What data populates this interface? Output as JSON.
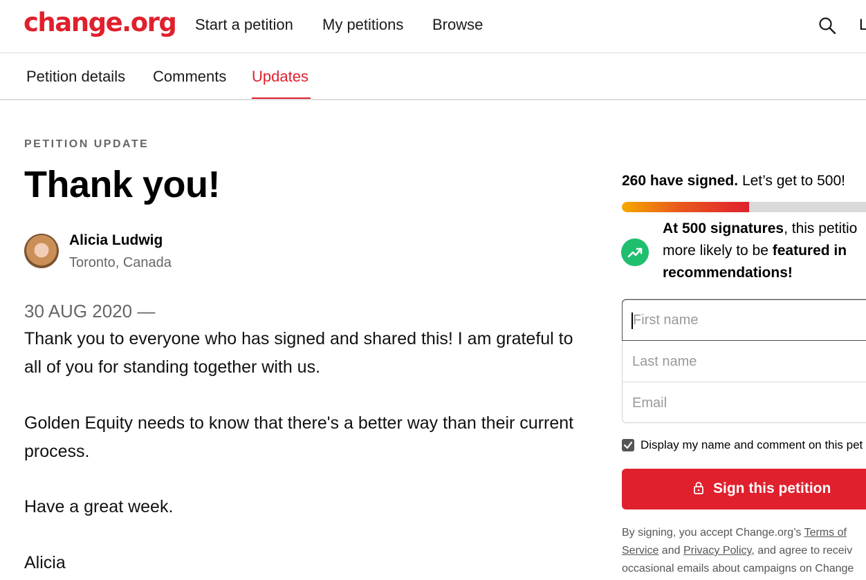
{
  "header": {
    "logo": "change.org",
    "nav": [
      "Start a petition",
      "My petitions",
      "Browse"
    ],
    "login_partial": "L"
  },
  "tabs": [
    {
      "label": "Petition details",
      "active": false
    },
    {
      "label": "Comments",
      "active": false
    },
    {
      "label": "Updates",
      "active": true
    }
  ],
  "update": {
    "eyebrow": "PETITION UPDATE",
    "title": "Thank you!",
    "author": {
      "name": "Alicia Ludwig",
      "location": "Toronto, Canada"
    },
    "date": "30 AUG 2020 —",
    "paragraphs": [
      "Thank you to everyone who has signed and shared this! I am grateful to all of you for standing together with us.",
      "Golden Equity needs to know that there's a better way than their current process.",
      "Have a great week.",
      "Alicia"
    ]
  },
  "sidebar": {
    "signed_bold": "260 have signed.",
    "signed_rest": "Let’s get to 500!",
    "progress_fraction": 0.52,
    "milestone": {
      "line1_bold": "At 500 signatures",
      "line1_rest": ", this petitio",
      "line2_rest": "more likely to be ",
      "line2_bold": "featured in",
      "line3_bold": "recommendations!"
    },
    "form": {
      "first_name_placeholder": "First name",
      "last_name_placeholder": "Last name",
      "email_placeholder": "Email",
      "display_checkbox_label": "Display my name and comment on this pet",
      "display_checked": true,
      "sign_button": "Sign this petition"
    },
    "legal": {
      "line1": "By signing, you accept Change.org’s ",
      "terms_link_part1": "Terms of",
      "terms_link_part2": "Service",
      "and": " and ",
      "privacy_link": "Privacy Policy",
      "line2_rest": ", and agree to receiv",
      "line3": "occasional emails about campaigns on Change"
    },
    "colors": {
      "brand": "#e0202d",
      "trend": "#1fbf6f"
    }
  }
}
